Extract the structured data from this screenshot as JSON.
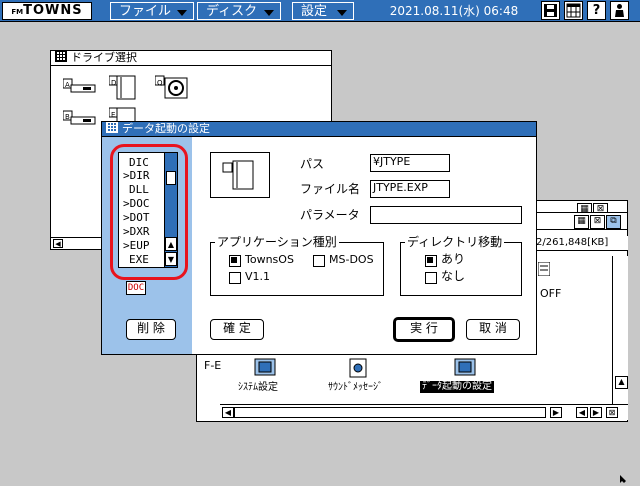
{
  "menubar": {
    "logo": "TOWNS",
    "logo_prefix": "FM",
    "menus": [
      "ファイル",
      "ディスク",
      "設定"
    ],
    "clock": "2021.08.11(水) 06:48",
    "sys_icons": [
      "save-icon",
      "grid-icon",
      "help-icon",
      "person-icon"
    ],
    "help_glyph": "?"
  },
  "drive_window": {
    "title": "ドライブ選択",
    "drives": [
      "A",
      "D",
      "Q",
      "B",
      "E"
    ]
  },
  "back_window": {
    "size_text": "2/261,848[KB]",
    "partial_label": "OFF",
    "left_partial": "F-E",
    "icons": [
      {
        "label": "ｼｽﾃﾑ設定",
        "selected": false
      },
      {
        "label": "ｻｳﾝﾄﾞﾒｯｾｰｼﾞ",
        "selected": false
      },
      {
        "label": "ﾃﾞｰﾀ起動の設定",
        "selected": true
      }
    ]
  },
  "dialog": {
    "title": "データ起動の設定",
    "extensions": [
      "DIC",
      ">DIR",
      "DLL",
      ">DOC",
      ">DOT",
      ">DXR",
      ">EUP",
      "EXE"
    ],
    "ext_badge": "DOC",
    "delete_button": "削 除",
    "path_label": "パス",
    "path_value": "¥JTYPE",
    "filename_label": "ファイル名",
    "filename_value": "JTYPE.EXP",
    "param_label": "パラメータ",
    "param_value": "",
    "app_type_group": "アプリケーション種別",
    "app_types": [
      {
        "label": "TownsOS",
        "checked": true
      },
      {
        "label": "MS-DOS",
        "checked": false
      },
      {
        "label": "V1.1",
        "checked": false
      }
    ],
    "dir_move_group": "ディレクトリ移動",
    "dir_move": [
      {
        "label": "あり",
        "checked": true
      },
      {
        "label": "なし",
        "checked": false
      }
    ],
    "confirm_button": "確 定",
    "run_button": "実 行",
    "cancel_button": "取 消"
  },
  "colors": {
    "accent_blue": "#2f6fb8",
    "panel_light_blue": "#9cc2ea",
    "desktop_gray": "#c8c8c8",
    "highlight_red": "#e8141e"
  }
}
